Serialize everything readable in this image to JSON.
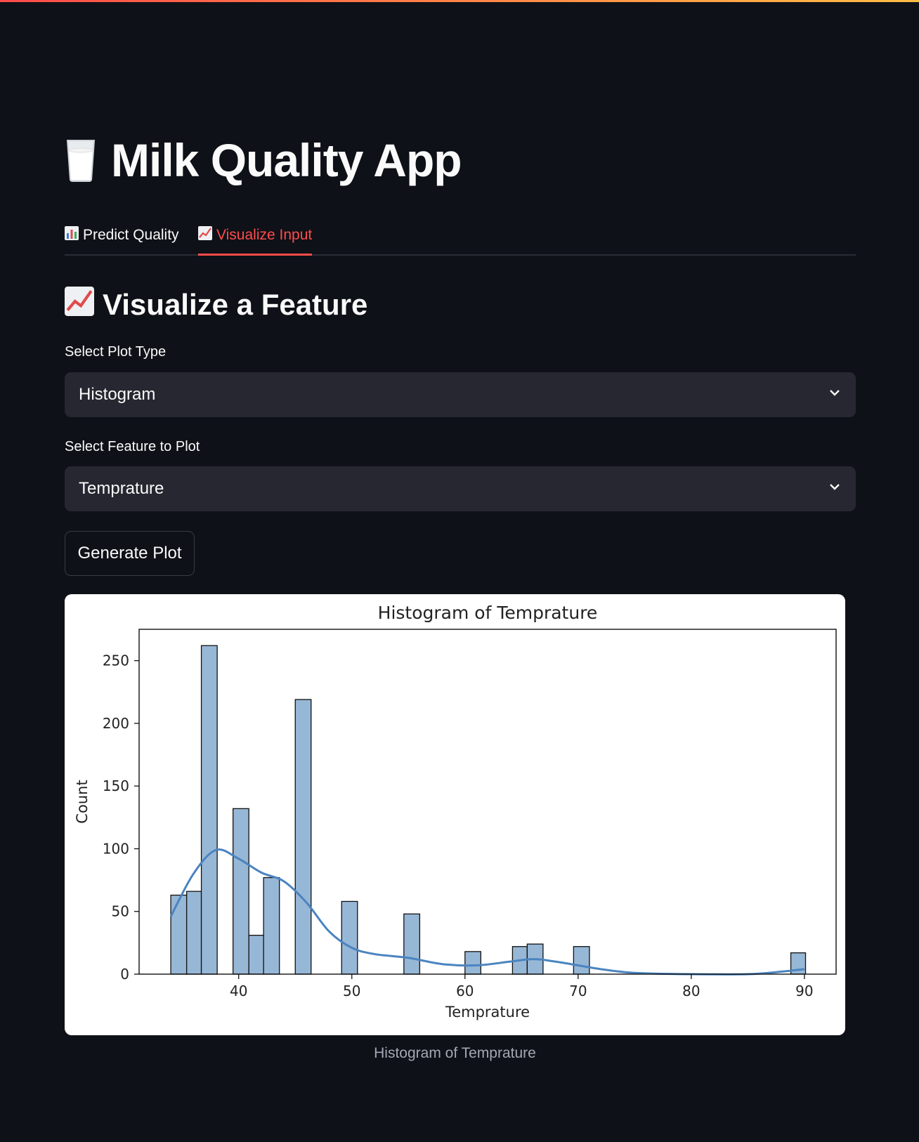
{
  "app": {
    "title": "Milk Quality App",
    "title_icon": "milk-glass-icon"
  },
  "tabs": [
    {
      "label": "Predict Quality",
      "icon": "bar-chart-icon",
      "active": false
    },
    {
      "label": "Visualize Input",
      "icon": "line-chart-icon",
      "active": true
    }
  ],
  "section": {
    "title": "Visualize a Feature",
    "icon": "line-chart-icon"
  },
  "plot_type": {
    "label": "Select Plot Type",
    "value": "Histogram"
  },
  "feature": {
    "label": "Select Feature to Plot",
    "value": "Temprature"
  },
  "generate_button": {
    "label": "Generate Plot"
  },
  "chart_caption": "Histogram of Temprature",
  "colors": {
    "accent": "#ff4b4b",
    "bar_fill": "#97b7d6",
    "kde_line": "#4a84c0"
  },
  "chart_data": {
    "type": "bar",
    "title": "Histogram of Temprature",
    "xlabel": "Temprature",
    "ylabel": "Count",
    "xlim": [
      31.2,
      92.8
    ],
    "ylim": [
      0,
      275
    ],
    "xticks": [
      40,
      50,
      60,
      70,
      80,
      90
    ],
    "yticks": [
      0,
      50,
      100,
      150,
      200,
      250
    ],
    "bins": [
      {
        "x0": 34.0,
        "x1": 35.4,
        "count": 63
      },
      {
        "x0": 35.4,
        "x1": 36.7,
        "count": 66
      },
      {
        "x0": 36.7,
        "x1": 38.1,
        "count": 262
      },
      {
        "x0": 39.5,
        "x1": 40.9,
        "count": 132
      },
      {
        "x0": 40.9,
        "x1": 42.2,
        "count": 31
      },
      {
        "x0": 42.2,
        "x1": 43.6,
        "count": 77
      },
      {
        "x0": 45.0,
        "x1": 46.4,
        "count": 219
      },
      {
        "x0": 49.1,
        "x1": 50.5,
        "count": 58
      },
      {
        "x0": 54.6,
        "x1": 56.0,
        "count": 48
      },
      {
        "x0": 60.0,
        "x1": 61.4,
        "count": 18
      },
      {
        "x0": 64.2,
        "x1": 65.5,
        "count": 22
      },
      {
        "x0": 65.5,
        "x1": 66.9,
        "count": 24
      },
      {
        "x0": 69.6,
        "x1": 71.0,
        "count": 22
      },
      {
        "x0": 88.8,
        "x1": 90.1,
        "count": 17
      }
    ],
    "kde": {
      "x": [
        34,
        36,
        38,
        40,
        42,
        44,
        46,
        48,
        50,
        52,
        55,
        58,
        61,
        64,
        66,
        68,
        70,
        72,
        75,
        80,
        85,
        88,
        90
      ],
      "y": [
        46,
        80,
        99,
        92,
        81,
        74,
        57,
        34,
        21,
        16,
        13,
        8,
        7,
        10,
        12,
        10,
        7,
        4,
        1,
        0,
        0,
        2,
        4
      ]
    }
  }
}
